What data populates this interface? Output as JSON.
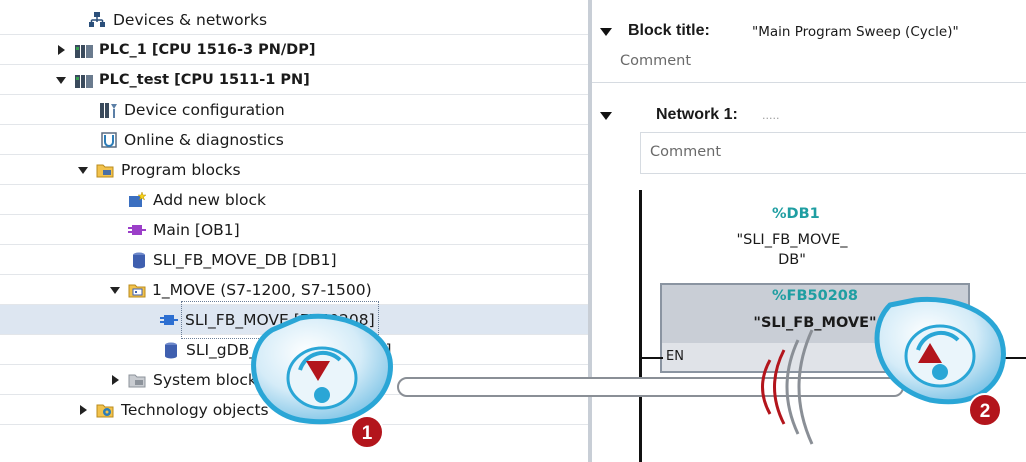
{
  "tree": {
    "items": [
      {
        "label": "Devices & networks",
        "icon": "devices-networks-icon"
      },
      {
        "label": "PLC_1 [CPU 1516-3 PN/DP]",
        "icon": "plc-icon",
        "expanded": false
      },
      {
        "label": "PLC_test [CPU 1511-1 PN]",
        "icon": "plc-icon",
        "expanded": true
      },
      {
        "label": "Device configuration",
        "icon": "device-config-icon"
      },
      {
        "label": "Online & diagnostics",
        "icon": "online-diagnostics-icon"
      },
      {
        "label": "Program blocks",
        "icon": "folder-icon",
        "expanded": true
      },
      {
        "label": "Add new block",
        "icon": "add-block-icon"
      },
      {
        "label": "Main [OB1]",
        "icon": "ob-block-icon"
      },
      {
        "label": "SLI_FB_MOVE_DB [DB1]",
        "icon": "db-block-icon"
      },
      {
        "label": "1_MOVE (S7-1200, S7-1500)",
        "icon": "library-folder-icon",
        "expanded": true
      },
      {
        "label": "SLI_FB_MOVE [FB50208]",
        "icon": "fb-block-icon",
        "selected": true
      },
      {
        "label": "SLI_gDB_MOVE [DB50208]",
        "icon": "db-block-icon"
      },
      {
        "label": "System blocks",
        "icon": "folder-gray-icon",
        "expanded": false
      },
      {
        "label": "Technology objects",
        "icon": "technology-icon",
        "expanded": false
      }
    ]
  },
  "editor": {
    "block_title_label": "Block title:",
    "block_title_value": "\"Main Program Sweep (Cycle)\"",
    "block_comment": "Comment",
    "network_label": "Network 1:",
    "network_title": ".....",
    "network_comment": "Comment",
    "db_address": "%DB1",
    "db_name_line1": "\"SLI_FB_MOVE_",
    "db_name_line2": "DB\"",
    "fb_address": "%FB50208",
    "fb_name": "\"SLI_FB_MOVE\"",
    "en_label": "EN"
  },
  "callouts": {
    "step1": "1",
    "step2": "2"
  },
  "colors": {
    "selection": "#dde6f1",
    "address_teal": "#1f9ea2",
    "callout_red": "#b3151c",
    "drag_blue": "#2aa6d6"
  }
}
